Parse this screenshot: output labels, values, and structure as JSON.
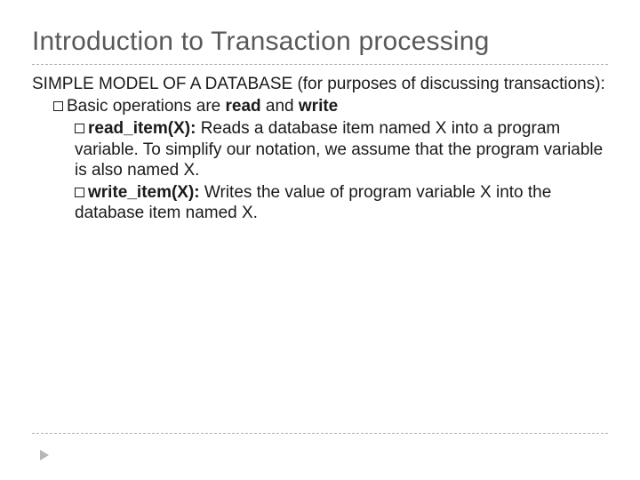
{
  "title": "Introduction to Transaction processing",
  "intro": "SIMPLE MODEL OF A DATABASE (for purposes of discussing transactions):",
  "basic_pre": "Basic operations are ",
  "basic_read": "read",
  "basic_and": " and ",
  "basic_write": "write",
  "read_label": "read_item(X):",
  "read_desc": " Reads a database item named X into a program variable. To simplify our notation, we assume that the program variable is also named X.",
  "write_label": "write_item(X):",
  "write_desc": " Writes the value of program variable X into the database item named X."
}
